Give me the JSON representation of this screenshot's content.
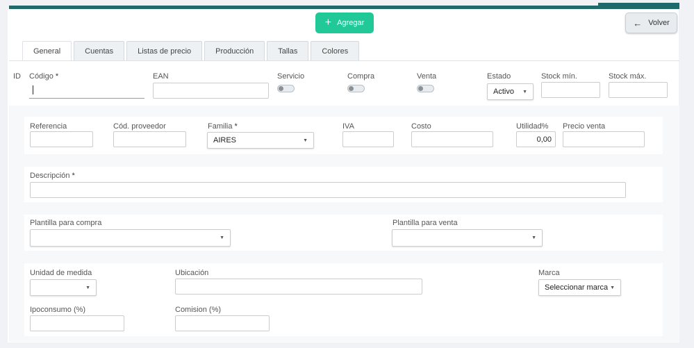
{
  "actions": {
    "add_label": "Agregar",
    "back_label": "Volver"
  },
  "tabs": [
    "General",
    "Cuentas",
    "Listas de precio",
    "Producción",
    "Tallas",
    "Colores"
  ],
  "row1": {
    "id": "ID",
    "codigo": "Código",
    "required": "*",
    "ean": "EAN",
    "servicio": "Servicio",
    "compra": "Compra",
    "venta": "Venta",
    "estado": "Estado",
    "estado_value": "Activo",
    "stock_min": "Stock mín.",
    "stock_max": "Stock máx."
  },
  "row2": {
    "referencia": "Referencia",
    "cod_proveedor": "Cód. proveedor",
    "familia": "Familia",
    "familia_value": "AIRES",
    "iva": "IVA",
    "costo": "Costo",
    "utilidad": "Utilidad%",
    "utilidad_value": "0,00",
    "precio_venta": "Precio venta"
  },
  "row3": {
    "descripcion": "Descripción"
  },
  "row4": {
    "plantilla_compra": "Plantilla para compra",
    "plantilla_venta": "Plantilla para venta"
  },
  "row5": {
    "unidad": "Unidad de medida",
    "ubicacion": "Ubicación",
    "marca": "Marca",
    "marca_value": "Seleccionar marca",
    "ipoconsumo": "Ipoconsumo (%)",
    "comision": "Comision (%)"
  },
  "icons": {
    "add": "plus-icon",
    "back": "arrow-left-icon",
    "dropdown": "caret-down-icon"
  },
  "colors": {
    "primary": "#20c997",
    "header": "#1e6b6b"
  }
}
